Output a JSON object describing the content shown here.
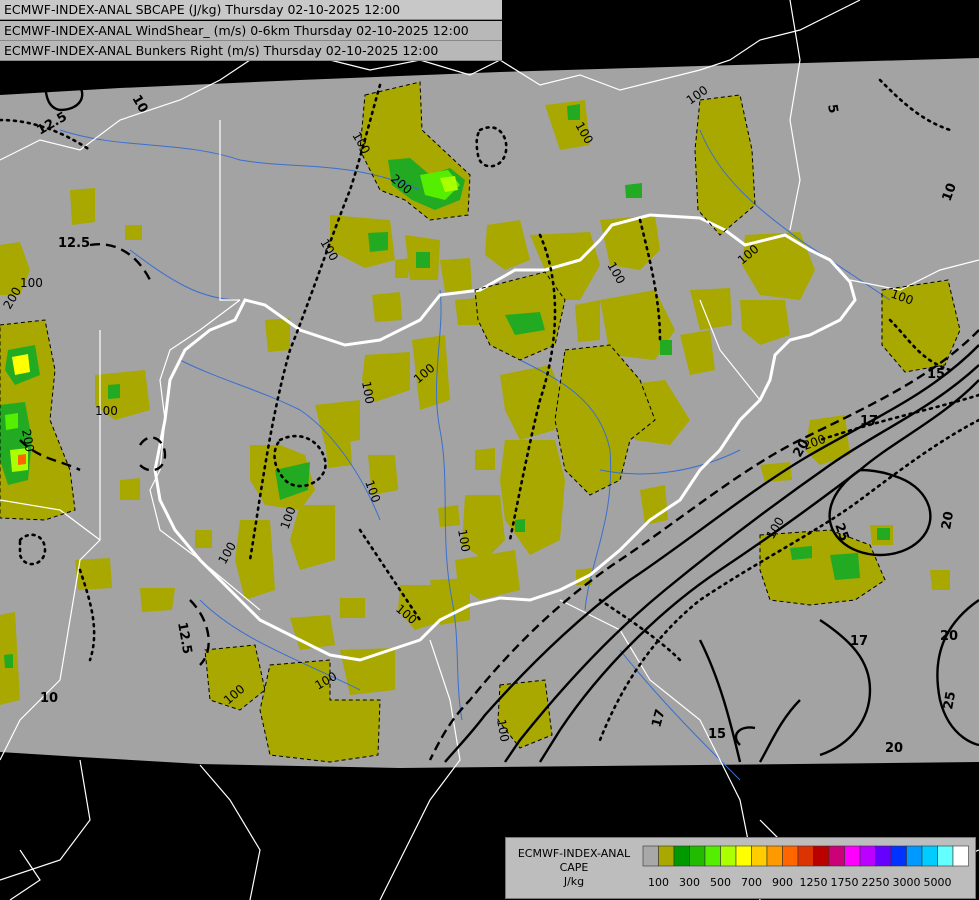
{
  "header": {
    "line1": "ECMWF-INDEX-ANAL SBCAPE (J/kg) Thursday 02-10-2025 12:00",
    "line2": "ECMWF-INDEX-ANAL WindShear_ (m/s) 0-6km Thursday 02-10-2025 12:00",
    "line3": "ECMWF-INDEX-ANAL Bunkers Right (m/s) Thursday 02-10-2025 12:00"
  },
  "legend": {
    "title_line1": "ECMWF-INDEX-ANAL",
    "title_line2": "CAPE",
    "title_line3": "J/kg",
    "swatches": [
      "#a8a8a8",
      "#a8a800",
      "#009900",
      "#22bb00",
      "#55ee00",
      "#aaff00",
      "#ffff00",
      "#ffcc00",
      "#ff9900",
      "#ff6600",
      "#dd3300",
      "#bb0000",
      "#cc0077",
      "#ff00ff",
      "#bb00ff",
      "#6600ff",
      "#0033ff",
      "#0099ff",
      "#00ccff",
      "#66ffff",
      "#ffffff"
    ],
    "tick_labels": [
      "100",
      "300",
      "500",
      "700",
      "900",
      "1250",
      "1750",
      "2250",
      "3000",
      "5000"
    ]
  },
  "contour_labels": {
    "shear": [
      "5",
      "5",
      "10",
      "10",
      "12.5",
      "12.5",
      "12.5",
      "15",
      "15",
      "17",
      "17",
      "17",
      "20",
      "20",
      "20",
      "20",
      "25",
      "25",
      "10"
    ],
    "cape": [
      "100",
      "100",
      "100",
      "100",
      "100",
      "100",
      "100",
      "100",
      "100",
      "100",
      "100",
      "100",
      "100",
      "100",
      "100",
      "100",
      "100",
      "100",
      "100",
      "200",
      "200",
      "200",
      "200",
      "100"
    ]
  },
  "colors": {
    "background": "#a3a3a3",
    "outside": "#000000",
    "cape_low": "#a8a800",
    "cape_mid": "#22aa22",
    "cape_high": "#55ee00",
    "border": "#ffffff",
    "river": "#3a6fd0"
  }
}
